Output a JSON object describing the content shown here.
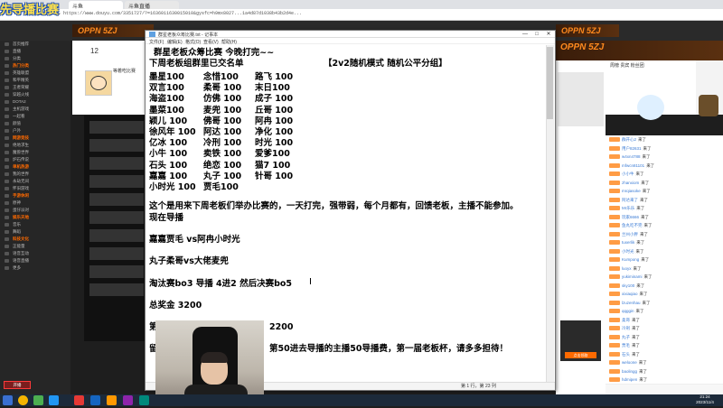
{
  "browser": {
    "tabs": [
      "先导播比赛",
      "斗鱼",
      "斗鱼直播"
    ],
    "url": "https://www.douyu.com/3351727/?=1636011630015010&gysfc=h9mx8027...1a4d87d1038b43b2d4e...",
    "nav": {
      "back": "←",
      "forward": "→",
      "refresh": "⟳"
    }
  },
  "overlay_logo": "先导播比赛",
  "site": {
    "banner_left": "OPPN 5ZJ",
    "banner_right": "OPPN 5ZJ"
  },
  "sidebar": {
    "items": [
      {
        "label": "首页推荐",
        "hdr": false
      },
      {
        "label": "直播",
        "hdr": false
      },
      {
        "label": "分类",
        "hdr": false
      },
      {
        "label": "热门分类",
        "hdr": true
      },
      {
        "label": "英雄联盟",
        "hdr": false
      },
      {
        "label": "和平精英",
        "hdr": false
      },
      {
        "label": "王者荣耀",
        "hdr": false
      },
      {
        "label": "穿越火线",
        "hdr": false
      },
      {
        "label": "DOTA2",
        "hdr": false
      },
      {
        "label": "主机游戏",
        "hdr": false
      },
      {
        "label": "一起看",
        "hdr": false
      },
      {
        "label": "颜值",
        "hdr": false
      },
      {
        "label": "户外",
        "hdr": false
      },
      {
        "label": "网游竞技",
        "hdr": true
      },
      {
        "label": "绝地求生",
        "hdr": false
      },
      {
        "label": "魔兽世界",
        "hdr": false
      },
      {
        "label": "炉石传说",
        "hdr": false
      },
      {
        "label": "单机热游",
        "hdr": true
      },
      {
        "label": "我的世界",
        "hdr": false
      },
      {
        "label": "永劫无间",
        "hdr": false
      },
      {
        "label": "怀旧游戏",
        "hdr": false
      },
      {
        "label": "手游休闲",
        "hdr": true
      },
      {
        "label": "原神",
        "hdr": false
      },
      {
        "label": "蛋仔派对",
        "hdr": false
      },
      {
        "label": "娱乐天地",
        "hdr": true
      },
      {
        "label": "音乐",
        "hdr": false
      },
      {
        "label": "舞蹈",
        "hdr": false
      },
      {
        "label": "科技文化",
        "hdr": true
      },
      {
        "label": "正能量",
        "hdr": false
      },
      {
        "label": "语音互动",
        "hdr": false
      },
      {
        "label": "语音直播",
        "hdr": false
      },
      {
        "label": "更多",
        "hdr": false
      }
    ],
    "buttons": [
      "开播",
      "下载"
    ]
  },
  "streamer": {
    "room_number": "12",
    "name": "等着吃比赛"
  },
  "notepad": {
    "title": "群星老板众筹比赛.txt - 记事本",
    "menu": [
      "文件(F)",
      "编辑(E)",
      "格式(O)",
      "查看(V)",
      "帮助(H)"
    ],
    "controls": [
      "—",
      "□",
      "✕"
    ],
    "status": "第 1 行，第 23 列",
    "heading": "群星老板众筹比赛 今晚打完~~",
    "subheading": "下周老板组群里已交名单",
    "mode": "【2v2随机模式 随机公平分组】",
    "roster": [
      [
        "墨星100",
        "念惜100",
        "路飞 100"
      ],
      [
        "双言100",
        "柔哥 100",
        "末日100"
      ],
      [
        "海盗100",
        "仿佛 100",
        "成子 100"
      ],
      [
        "墨菜100",
        "麦兜 100",
        "丘哥 100"
      ],
      [
        "颖儿 100",
        "佛哥 100",
        "阿冉 100"
      ],
      [
        "徐风年 100",
        "阿达 100",
        "净化 100"
      ],
      [
        "亿冰 100",
        "冷刑 100",
        "时光 100"
      ],
      [
        "小牛 100",
        "卖铁 100",
        "爱爹100"
      ],
      [
        "石头 100",
        "绝恋 100",
        "猫7 100"
      ],
      [
        "嘉嘉 100",
        "丸子 100",
        "针哥 100"
      ],
      [
        "小时光 100",
        "贾毛100",
        ""
      ]
    ],
    "paragraph1": "这个是用来下周老板们举办比赛的，一天打完，强带弱，每个月都有，回馈老板，主播不能参加。",
    "paragraph2": "现在导播",
    "match1": "嘉嘉贾毛 vs阿冉小时光",
    "match2": "丸子柔哥vs大佬麦兜",
    "format": "淘汰赛bo3 导播  4进2 然后决赛bo5",
    "prize": "总奖金 3200",
    "partial1_start": "第",
    "partial1_end": "2200",
    "partial2_start": "留",
    "partial2_end": "第50进去导播的主播50导播费，第一届老板杯，请多多担待！"
  },
  "right": {
    "banner": "OPPN 5ZJ",
    "rank_title": "周榜 贵宾 粉丝团",
    "ad_button": "点击领取"
  },
  "chat": [
    {
      "user": "群开心2",
      "msg": "来了"
    },
    {
      "user": "用户82631",
      "msg": "来了"
    },
    {
      "user": "w4xn4788",
      "msg": "来了"
    },
    {
      "user": "mfwcn81101",
      "msg": "来了"
    },
    {
      "user": "小小牛",
      "msg": "来了"
    },
    {
      "user": "zhanxiom",
      "msg": "来了"
    },
    {
      "user": "mrqiasoke",
      "msg": "来了"
    },
    {
      "user": "阿达来了",
      "msg": "来了"
    },
    {
      "user": "Mr乐乐",
      "msg": "来了"
    },
    {
      "user": "玩家6666",
      "msg": "来了"
    },
    {
      "user": "鱼丸吃不完",
      "msg": "来了"
    },
    {
      "user": "兰州小胖",
      "msg": "来了"
    },
    {
      "user": "tuxerlik",
      "msg": "来了"
    },
    {
      "user": "小时光",
      "msg": "来了"
    },
    {
      "user": "Kumpong",
      "msg": "来了"
    },
    {
      "user": "luoyx",
      "msg": "来了"
    },
    {
      "user": "yukiminami",
      "msg": "来了"
    },
    {
      "user": "sky100",
      "msg": "来了"
    },
    {
      "user": "xixiaqiao",
      "msg": "来了"
    },
    {
      "user": "lzuzenhau",
      "msg": "来了"
    },
    {
      "user": "qqggin",
      "msg": "来了"
    },
    {
      "user": "柔哥",
      "msg": "来了"
    },
    {
      "user": "冷刑",
      "msg": "来了"
    },
    {
      "user": "丸子",
      "msg": "来了"
    },
    {
      "user": "贾毛",
      "msg": "来了"
    },
    {
      "user": "石头",
      "msg": "来了"
    },
    {
      "user": "weloone",
      "msg": "来了"
    },
    {
      "user": "baolingg",
      "msg": "来了"
    },
    {
      "user": "hdmipen",
      "msg": "来了"
    }
  ],
  "taskbar": {
    "clock_time": "21:24",
    "clock_date": "2023/11/4"
  },
  "colors": {
    "accent": "#ff6a00",
    "logo": "#ffe14a"
  }
}
